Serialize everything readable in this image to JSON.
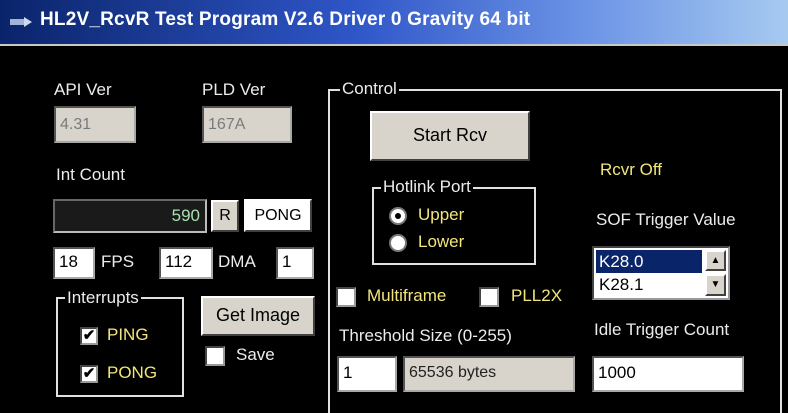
{
  "window": {
    "title": "HL2V_RcvR Test Program V2.6    Driver 0  Gravity 64 bit"
  },
  "api": {
    "label": "API Ver",
    "value": "4.31"
  },
  "pld": {
    "label": "PLD Ver",
    "value": "167A"
  },
  "int_count": {
    "label": "Int Count",
    "value": "590",
    "reset_label": "R",
    "pong_label": "PONG"
  },
  "rates": {
    "fps_value": "18",
    "fps_label": "FPS",
    "dma_value": "112",
    "dma_label": "DMA",
    "dma_count": "1"
  },
  "interrupts": {
    "title": "Interrupts",
    "ping_label": "PING",
    "ping_checked": true,
    "pong_label": "PONG",
    "pong_checked": true
  },
  "get_image_label": "Get Image",
  "save": {
    "label": "Save",
    "checked": false
  },
  "control": {
    "title": "Control",
    "start_label": "Start Rcv",
    "hotlink": {
      "title": "Hotlink Port",
      "upper_label": "Upper",
      "lower_label": "Lower",
      "selected": "Upper"
    },
    "multiframe_label": "Multiframe",
    "pll2x_label": "PLL2X",
    "threshold_label": "Threshold Size (0-255)",
    "threshold_value": "1",
    "bytes_value": "65536 bytes",
    "status": "Rcvr Off",
    "sof": {
      "label": "SOF Trigger  Value",
      "options": [
        "K28.0",
        "K28.1"
      ],
      "selected": "K28.0"
    },
    "idle": {
      "label": "Idle Trigger Count",
      "value": "1000"
    }
  },
  "colors": {
    "highlight": "#0a246a",
    "status_text": "#f2e67a",
    "count_text": "#a7e0b0"
  }
}
